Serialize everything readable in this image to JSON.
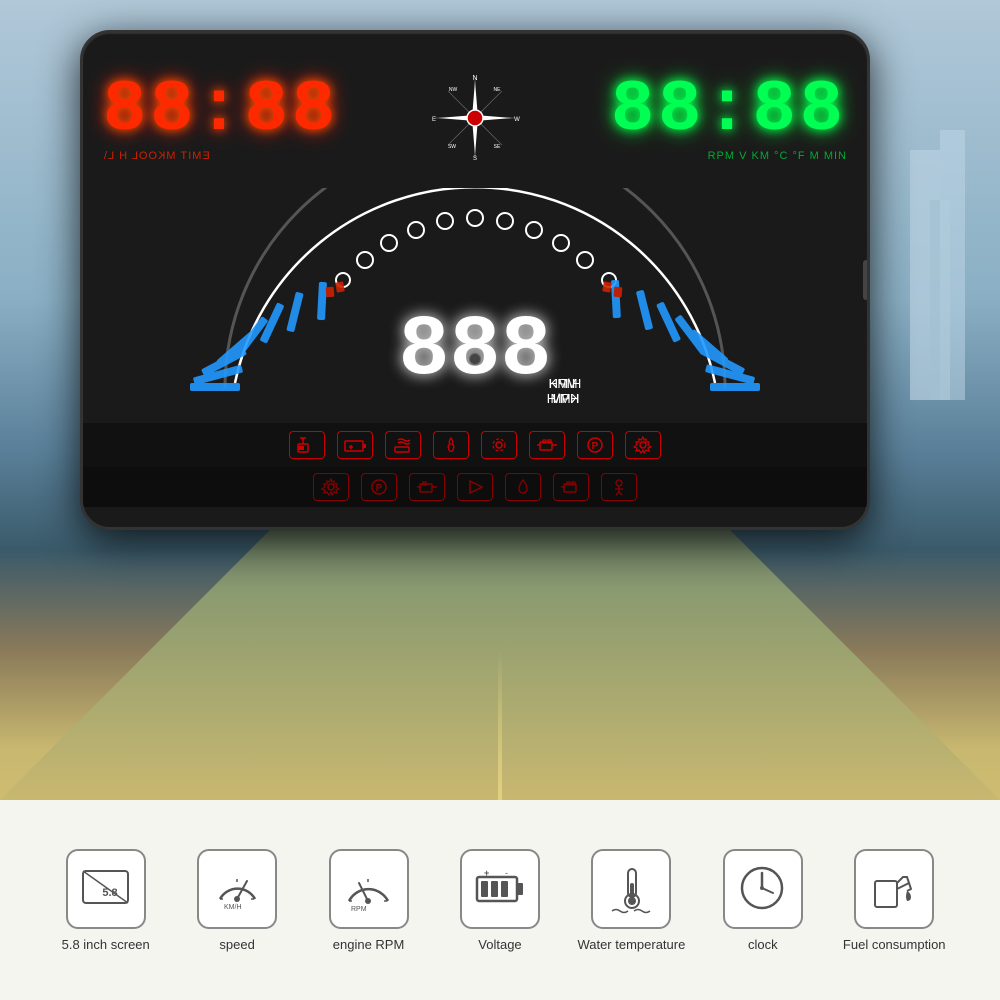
{
  "background": {
    "sky_color": "#b0c8d8",
    "road_color": "#8a9a70"
  },
  "device": {
    "display": {
      "red_digits": "88:88",
      "green_digits": "88:88",
      "red_label": "EMIT MKOOL H L\\",
      "green_label": "RPM V KM °C °F M MIN",
      "speed_digits": "888",
      "speed_units": "MPH\nKM\\H",
      "compass_directions": [
        "N",
        "NE",
        "E",
        "SE",
        "S",
        "SW",
        "W",
        "NW"
      ]
    }
  },
  "features": [
    {
      "id": "screen-size",
      "label": "5.8 inch screen",
      "icon": "screen-icon"
    },
    {
      "id": "speed",
      "label": "speed",
      "icon": "speedometer-icon"
    },
    {
      "id": "engine-rpm",
      "label": "engine RPM",
      "icon": "rpm-icon"
    },
    {
      "id": "voltage",
      "label": "Voltage",
      "icon": "battery-icon"
    },
    {
      "id": "water-temp",
      "label": "Water temperature",
      "icon": "thermometer-icon"
    },
    {
      "id": "clock",
      "label": "clock",
      "icon": "clock-icon"
    },
    {
      "id": "fuel-consumption",
      "label": "Fuel consumption",
      "icon": "fuel-icon"
    }
  ],
  "warning_icons": [
    "fuel-level",
    "battery",
    "coffee",
    "fire",
    "settings",
    "engine",
    "brake",
    "gear"
  ]
}
